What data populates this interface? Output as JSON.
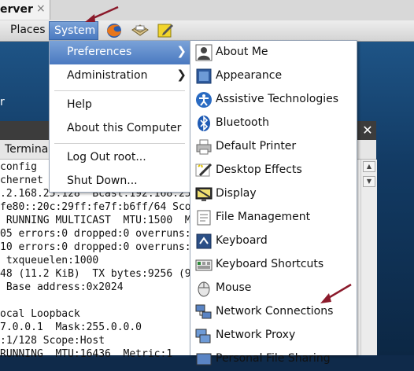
{
  "tab": {
    "label": "erver",
    "close": "×"
  },
  "panel": {
    "places": "Places",
    "system": "System"
  },
  "desktop": {
    "fragment": "r"
  },
  "terminal": {
    "close": "✕",
    "menu_terminal": "Terminal",
    "lines": [
      "config",
      "chernet",
      ".2.168.25.128  Bcast:192.168.25.",
      "fe80::20c:29ff:fe7f:b6ff/64 Sco",
      " RUNNING MULTICAST  MTU:1500  M",
      "05 errors:0 dropped:0 overruns:",
      "10 errors:0 dropped:0 overruns:",
      " txqueuelen:1000",
      "48 (11.2 KiB)  TX bytes:9256 (9",
      " Base address:0x2024",
      "",
      "ocal Loopback",
      "7.0.0.1  Mask:255.0.0.0",
      ":1/128 Scope:Host",
      "RUNNING  MTU:16436  Metric:1"
    ]
  },
  "system_menu": {
    "items": [
      {
        "label": "Preferences",
        "submenu": true
      },
      {
        "label": "Administration",
        "submenu": true
      },
      {
        "label": "Help"
      },
      {
        "label": "About this Computer"
      },
      {
        "label": "Log Out root..."
      },
      {
        "label": "Shut Down..."
      }
    ]
  },
  "preferences_menu": {
    "items": [
      {
        "label": "About Me",
        "icon": "person-icon"
      },
      {
        "label": "Appearance",
        "icon": "appearance-icon"
      },
      {
        "label": "Assistive Technologies",
        "icon": "accessibility-icon"
      },
      {
        "label": "Bluetooth",
        "icon": "bluetooth-icon"
      },
      {
        "label": "Default Printer",
        "icon": "printer-icon"
      },
      {
        "label": "Desktop Effects",
        "icon": "desktop-effects-icon"
      },
      {
        "label": "Display",
        "icon": "display-icon"
      },
      {
        "label": "File Management",
        "icon": "file-management-icon"
      },
      {
        "label": "Keyboard",
        "icon": "keyboard-icon"
      },
      {
        "label": "Keyboard Shortcuts",
        "icon": "keyboard-shortcuts-icon"
      },
      {
        "label": "Mouse",
        "icon": "mouse-icon"
      },
      {
        "label": "Network Connections",
        "icon": "network-icon"
      },
      {
        "label": "Network Proxy",
        "icon": "network-proxy-icon"
      },
      {
        "label": "Personal File Sharing",
        "icon": "file-sharing-icon"
      }
    ]
  },
  "colors": {
    "highlight": "#5a87c9",
    "annotation": "#8b1a2b"
  }
}
